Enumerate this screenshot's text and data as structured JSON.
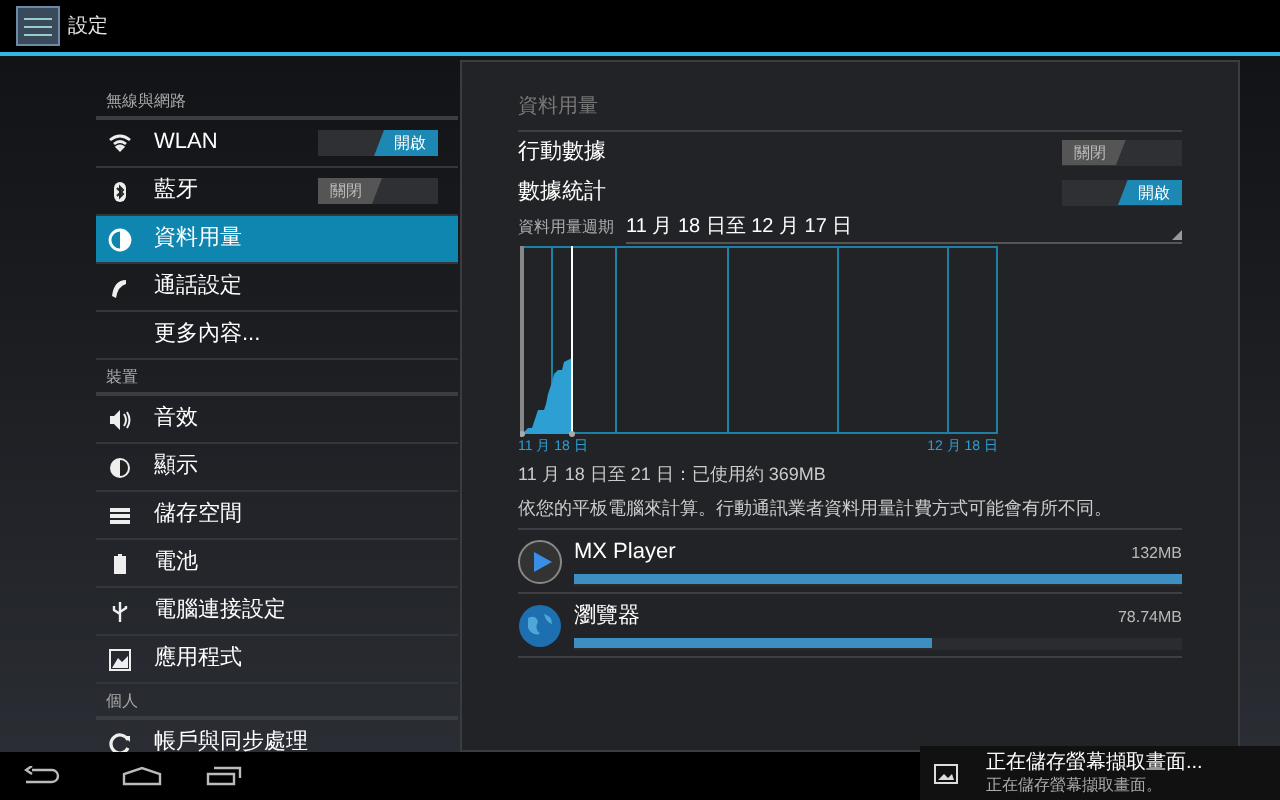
{
  "action_bar": {
    "title": "設定"
  },
  "sidebar": {
    "sections": [
      {
        "header": "無線與網路",
        "items": [
          {
            "label": "WLAN",
            "selected": false,
            "switch": {
              "label": "開啟",
              "on": true
            }
          },
          {
            "label": "藍牙",
            "selected": false,
            "switch": {
              "label": "關閉",
              "on": false
            }
          },
          {
            "label": "資料用量",
            "selected": true
          },
          {
            "label": "通話設定",
            "selected": false
          },
          {
            "label": "更多內容...",
            "selected": false
          }
        ]
      },
      {
        "header": "裝置",
        "items": [
          {
            "label": "音效",
            "selected": false
          },
          {
            "label": "顯示",
            "selected": false
          },
          {
            "label": "儲存空間",
            "selected": false
          },
          {
            "label": "電池",
            "selected": false
          },
          {
            "label": "電腦連接設定",
            "selected": false
          },
          {
            "label": "應用程式",
            "selected": false
          }
        ]
      },
      {
        "header": "個人",
        "items": [
          {
            "label": "帳戶與同步處理",
            "selected": false
          }
        ]
      }
    ]
  },
  "panel": {
    "title": "資料用量",
    "toggles": [
      {
        "label": "行動數據",
        "switch": {
          "label": "關閉",
          "on": false
        }
      },
      {
        "label": "數據統計",
        "switch": {
          "label": "開啟",
          "on": true
        }
      }
    ],
    "cycle": {
      "label": "資料用量週期",
      "value": "11 月 18 日至 12 月 17 日"
    },
    "chart_labels": [
      "11 月 18 日",
      "12 月 18 日"
    ],
    "summary": "11 月 18 日至 21 日：已使用約 369MB",
    "note": "依您的平板電腦來計算。行動通訊業者資料用量計費方式可能會有所不同。",
    "apps": [
      {
        "name": "MX Player",
        "usage": "132MB",
        "level": 1.0
      },
      {
        "name": "瀏覽器",
        "usage": "78.74MB",
        "level": 0.59
      }
    ]
  },
  "notification": {
    "title": "正在儲存螢幕擷取畫面...",
    "text": "正在儲存螢幕擷取畫面。"
  }
}
